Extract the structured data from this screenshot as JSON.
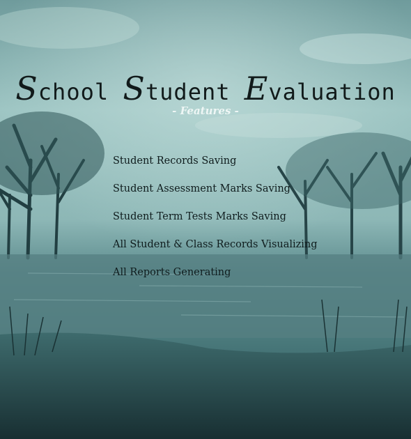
{
  "title": {
    "words": [
      {
        "cap": "S",
        "rest": "chool"
      },
      {
        "cap": "S",
        "rest": "tudent"
      },
      {
        "cap": "E",
        "rest": "valuation"
      }
    ]
  },
  "subtitle": "- Features -",
  "features": [
    "Student Records Saving",
    "Student Assessment Marks Saving",
    "Student Term Tests Marks Saving",
    "All Student & Class Records Visualizing",
    "All Reports Generating"
  ],
  "colors": {
    "sky_top": "#9ec6c4",
    "mist": "#7fa9a9",
    "water": "#4d7a7d",
    "grass": "#1f3a3d",
    "title_text": "#111a1a",
    "subtitle_text": "#eef6f5"
  }
}
